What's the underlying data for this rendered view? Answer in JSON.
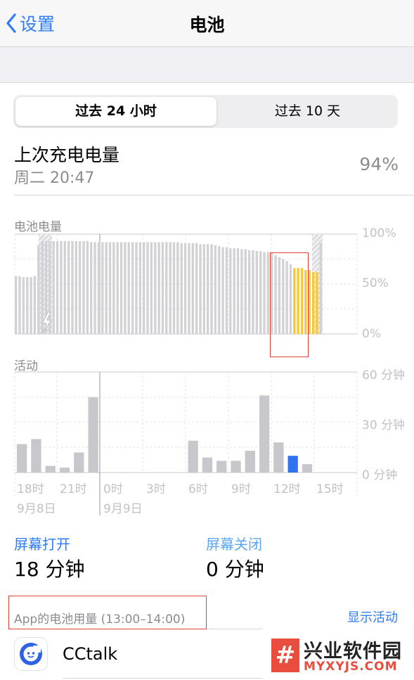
{
  "nav": {
    "back_label": "设置",
    "title": "电池"
  },
  "segments": {
    "active": "过去 24 小时",
    "inactive": "过去 10 天"
  },
  "last_charge": {
    "title": "上次充电电量",
    "time": "周二 20:47",
    "percent": "94%"
  },
  "battery_chart": {
    "label": "电池电量",
    "y_ticks": [
      "100%",
      "50%",
      "0%"
    ]
  },
  "activity_chart": {
    "label": "活动",
    "y_ticks": [
      "60 分钟",
      "30 分钟",
      "0 分钟"
    ],
    "x_ticks": [
      "18时",
      "21时",
      "0时",
      "3时",
      "6时",
      "9时",
      "12时",
      "15时"
    ],
    "dates": [
      "9月8日",
      "9月9日"
    ]
  },
  "stats": {
    "screen_on_label": "屏幕打开",
    "screen_on_value": "18 分钟",
    "screen_off_label": "屏幕关闭",
    "screen_off_value": "0 分钟"
  },
  "usage": {
    "label": "App的电池用量 (13:00–14:00)",
    "show_activity": "显示活动"
  },
  "apps": [
    {
      "name": "CCtalk"
    }
  ],
  "watermark": {
    "name": "兴业软件园",
    "domain": "MYXYJS.COM",
    "glyph": "#"
  },
  "colors": {
    "accent": "#2e7cf6",
    "bar_gray": "#c7c7cc",
    "bar_yellow": "#f6c935",
    "bar_blue": "#2f73f0"
  },
  "chart_data": [
    {
      "type": "bar",
      "title": "电池电量",
      "ylim": [
        0,
        100
      ],
      "y_ticks": [
        "0%",
        "50%",
        "100%"
      ],
      "charging_intervals": [
        "first hour block",
        "last hour block"
      ],
      "selected_hour": "13:00–14:00",
      "values": [
        58,
        58,
        57,
        57,
        57,
        58,
        89,
        93,
        93,
        93,
        93,
        93,
        93,
        93,
        93,
        93,
        93,
        93,
        93,
        93,
        92,
        92,
        92,
        92,
        92,
        92,
        92,
        92,
        92,
        92,
        92,
        92,
        92,
        92,
        92,
        92,
        92,
        92,
        92,
        92,
        92,
        92,
        92,
        92,
        91,
        91,
        91,
        91,
        91,
        90,
        90,
        90,
        90,
        89,
        88,
        87,
        87,
        86,
        86,
        86,
        85,
        85,
        84,
        84,
        83,
        83,
        82,
        82,
        81,
        79,
        77,
        75,
        73,
        70,
        66,
        66,
        66,
        64,
        64,
        62,
        62,
        91
      ]
    },
    {
      "type": "bar",
      "title": "活动",
      "ylabel": "分钟",
      "ylim": [
        0,
        60
      ],
      "categories": [
        "18时",
        "19时",
        "20时",
        "21时",
        "22时",
        "23时",
        "0时",
        "1时",
        "2时",
        "3时",
        "4时",
        "5时",
        "6时",
        "7时",
        "8时",
        "9时",
        "10时",
        "11时",
        "12时",
        "13时",
        "14时",
        "15时"
      ],
      "values": [
        17,
        20,
        4,
        3,
        12,
        45,
        0,
        0,
        0,
        0,
        0,
        0,
        19,
        9,
        7,
        7,
        13,
        46,
        18,
        10,
        5,
        0
      ],
      "highlight_index": 19
    }
  ]
}
